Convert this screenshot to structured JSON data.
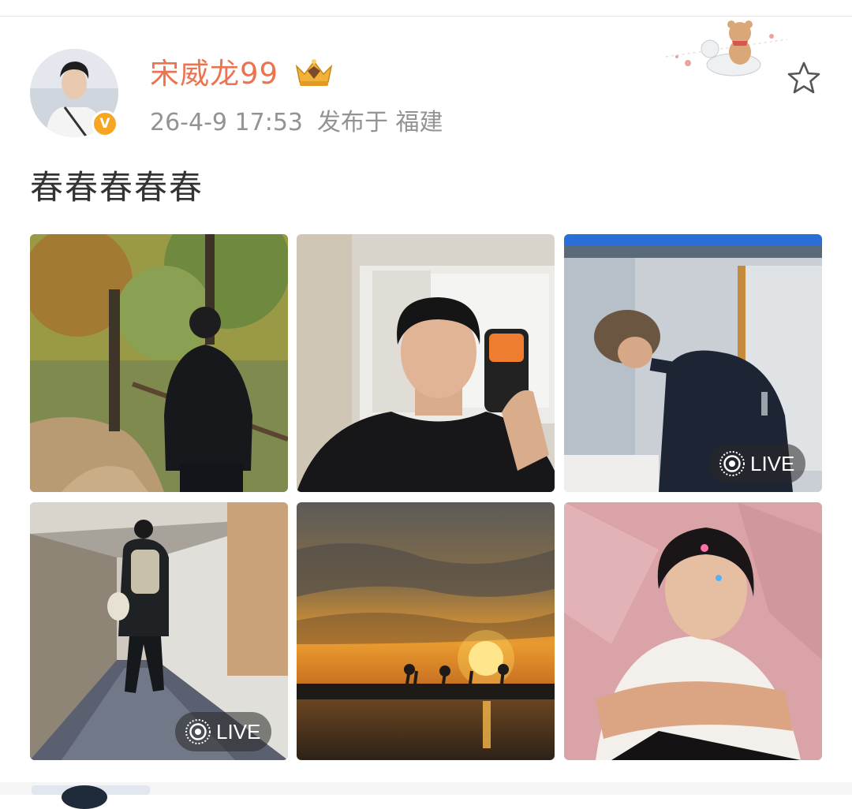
{
  "post": {
    "username": "宋威龙99",
    "timestamp": "26-4-9 17:53",
    "published_from": "发布于 福建",
    "text": "春春春春春",
    "verified_badge": "V",
    "crown_icon": "vip-crown-icon",
    "favorite_icon": "star-outline-icon"
  },
  "photos": [
    {
      "scene": "forest-path-walk"
    },
    {
      "scene": "mirror-selfie"
    },
    {
      "scene": "indoor-bending",
      "live": "LIVE"
    },
    {
      "scene": "hotel-corridor",
      "live": "LIVE"
    },
    {
      "scene": "sunset-lake"
    },
    {
      "scene": "pink-backdrop-portrait"
    }
  ],
  "colors": {
    "username": "#eb7350",
    "meta": "#939393",
    "text": "#333333",
    "badge": "#f6a623"
  }
}
